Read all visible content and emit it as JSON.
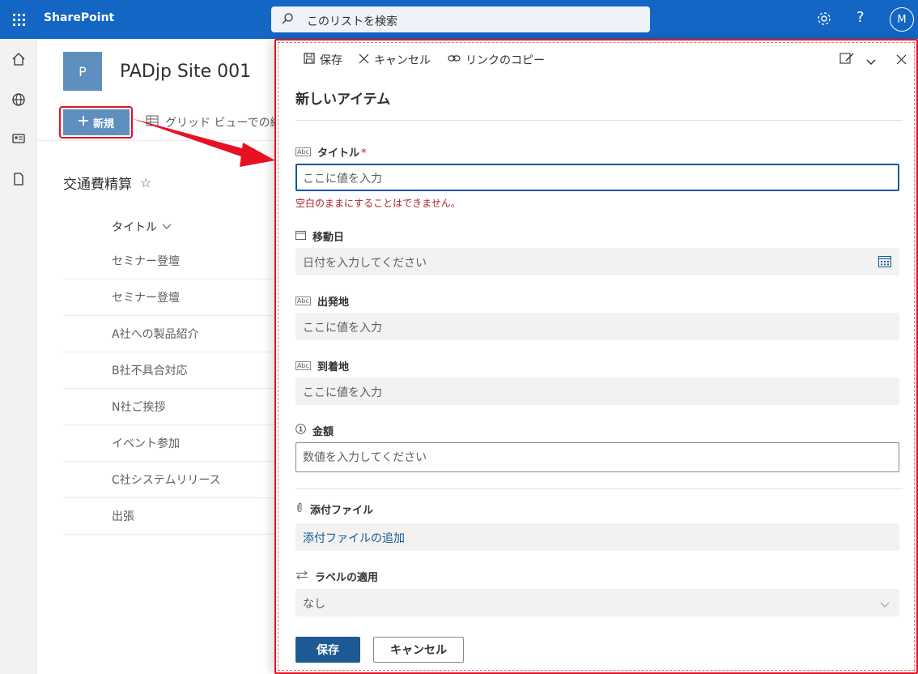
{
  "suite": {
    "app_name": "SharePoint",
    "search_placeholder": "このリストを検索",
    "help_label": "?",
    "user_initial": "M",
    "accent": "#1366c4"
  },
  "rail": {
    "icons": [
      "home-icon",
      "globe-icon",
      "news-icon",
      "file-icon"
    ]
  },
  "site": {
    "logo_letter": "P",
    "title": "PADjp Site 001"
  },
  "command_bar": {
    "new_label": "新規",
    "grid_view_label": "グリッド ビューでの編"
  },
  "list": {
    "title": "交通費精算",
    "column_title": "タイトル",
    "rows": [
      "セミナー登壇",
      "セミナー登壇",
      "A社への製品紹介",
      "B社不具合対応",
      "N社ご挨拶",
      "イベント参加",
      "C社システムリリース",
      "出張"
    ]
  },
  "panel": {
    "toolbar": {
      "save": "保存",
      "cancel": "キャンセル",
      "copy_link": "リンクのコピー"
    },
    "heading": "新しいアイテム",
    "fields": {
      "title": {
        "label": "タイトル",
        "required_mark": "*",
        "placeholder": "ここに値を入力",
        "error": "空白のままにすることはできません。"
      },
      "travel_date": {
        "label": "移動日",
        "placeholder": "日付を入力してください"
      },
      "origin": {
        "label": "出発地",
        "placeholder": "ここに値を入力"
      },
      "destination": {
        "label": "到着地",
        "placeholder": "ここに値を入力"
      },
      "amount": {
        "label": "金額",
        "placeholder": "数値を入力してください"
      },
      "attachments": {
        "label": "添付ファイル",
        "link": "添付ファイルの追加"
      },
      "label_apply": {
        "label": "ラベルの適用",
        "value": "なし"
      }
    },
    "buttons": {
      "save": "保存",
      "cancel": "キャンセル"
    },
    "highlight_color": "#e81123"
  }
}
